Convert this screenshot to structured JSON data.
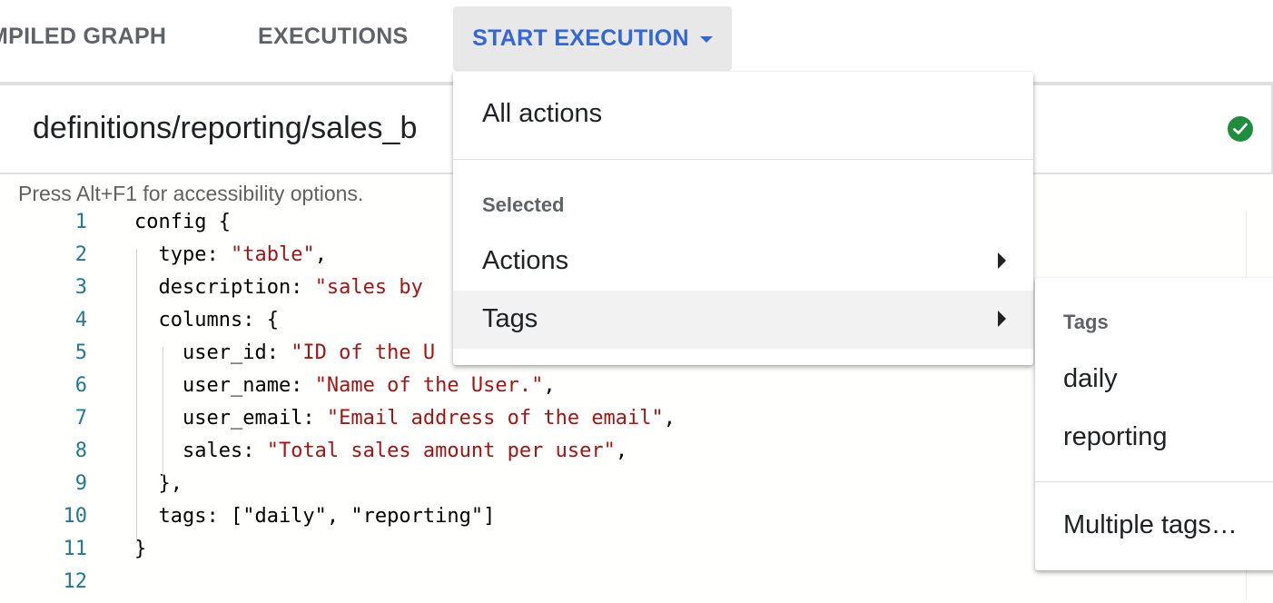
{
  "tabs": {
    "compiled_graph": "MPILED GRAPH",
    "executions": "EXECUTIONS",
    "start_execution": "START EXECUTION"
  },
  "file": {
    "path": "definitions/reporting/sales_b",
    "status_icon": "check-circle-icon",
    "status_color": "#1e8e3e"
  },
  "editor": {
    "accessibility_hint": "Press Alt+F1 for accessibility options.",
    "lines": [
      {
        "num": "1",
        "parts": [
          {
            "t": "config {",
            "c": "p"
          }
        ]
      },
      {
        "num": "2",
        "parts": [
          {
            "t": "  type: ",
            "c": "p"
          },
          {
            "t": "\"table\"",
            "c": "s"
          },
          {
            "t": ",",
            "c": "p"
          }
        ]
      },
      {
        "num": "3",
        "parts": [
          {
            "t": "  description: ",
            "c": "p"
          },
          {
            "t": "\"sales by",
            "c": "s"
          }
        ]
      },
      {
        "num": "4",
        "parts": [
          {
            "t": "  columns: {",
            "c": "p"
          }
        ]
      },
      {
        "num": "5",
        "parts": [
          {
            "t": "    user_id: ",
            "c": "p"
          },
          {
            "t": "\"ID of the U",
            "c": "s"
          }
        ]
      },
      {
        "num": "6",
        "parts": [
          {
            "t": "    user_name: ",
            "c": "p"
          },
          {
            "t": "\"Name of the User.\"",
            "c": "s"
          },
          {
            "t": ",",
            "c": "p"
          }
        ]
      },
      {
        "num": "7",
        "parts": [
          {
            "t": "    user_email: ",
            "c": "p"
          },
          {
            "t": "\"Email address of the email\"",
            "c": "s"
          },
          {
            "t": ",",
            "c": "p"
          }
        ]
      },
      {
        "num": "8",
        "parts": [
          {
            "t": "    sales: ",
            "c": "p"
          },
          {
            "t": "\"Total sales amount per user\"",
            "c": "s"
          },
          {
            "t": ",",
            "c": "p"
          }
        ]
      },
      {
        "num": "9",
        "parts": [
          {
            "t": "  },",
            "c": "p"
          }
        ]
      },
      {
        "num": "10",
        "parts": [
          {
            "t": "  tags: [\"daily\", \"reporting\"]",
            "c": "p"
          }
        ]
      },
      {
        "num": "11",
        "parts": [
          {
            "t": "}",
            "c": "p"
          }
        ]
      },
      {
        "num": "12",
        "parts": []
      }
    ]
  },
  "main_menu": {
    "all_actions": "All actions",
    "selected_header": "Selected",
    "actions": "Actions",
    "tags": "Tags"
  },
  "tags_submenu": {
    "header": "Tags",
    "items": [
      "daily",
      "reporting"
    ],
    "multiple": "Multiple tags…"
  },
  "colors": {
    "accent": "#3367d6",
    "string": "#a31515",
    "line_number": "#237893"
  }
}
